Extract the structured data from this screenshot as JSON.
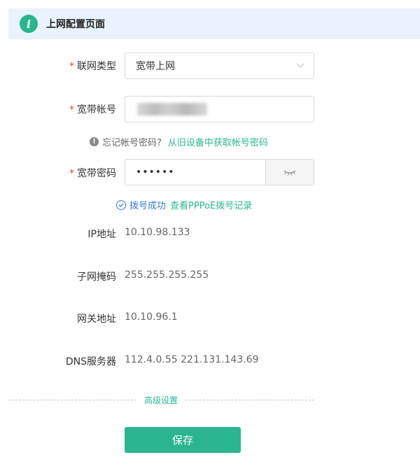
{
  "header": {
    "title": "上网配置页面",
    "info_icon_glyph": "i",
    "accent_color": "#2bb58f",
    "banner_bg": "#e8f3fd"
  },
  "form": {
    "required_mark": "*",
    "connection_type": {
      "label": "联网类型",
      "value": "宽带上网"
    },
    "account": {
      "label": "宽带帐号",
      "value_obscured": true
    },
    "forgot_hint": {
      "icon_glyph": "!",
      "text": "忘记帐号密码?",
      "link": "从旧设备中获取帐号密码"
    },
    "password": {
      "label": "宽带密码",
      "value": "••••••"
    },
    "dial_status": {
      "text": "拨号成功",
      "link": "查看PPPoE拨号记录"
    },
    "ip": {
      "label": "IP地址",
      "value": "10.10.98.133"
    },
    "subnet": {
      "label": "子网掩码",
      "value": "255.255.255.255"
    },
    "gateway": {
      "label": "网关地址",
      "value": "10.10.96.1"
    },
    "dns": {
      "label": "DNS服务器",
      "value": "112.4.0.55 221.131.143.69"
    }
  },
  "advanced_settings": "高级设置",
  "save_button": "保存"
}
